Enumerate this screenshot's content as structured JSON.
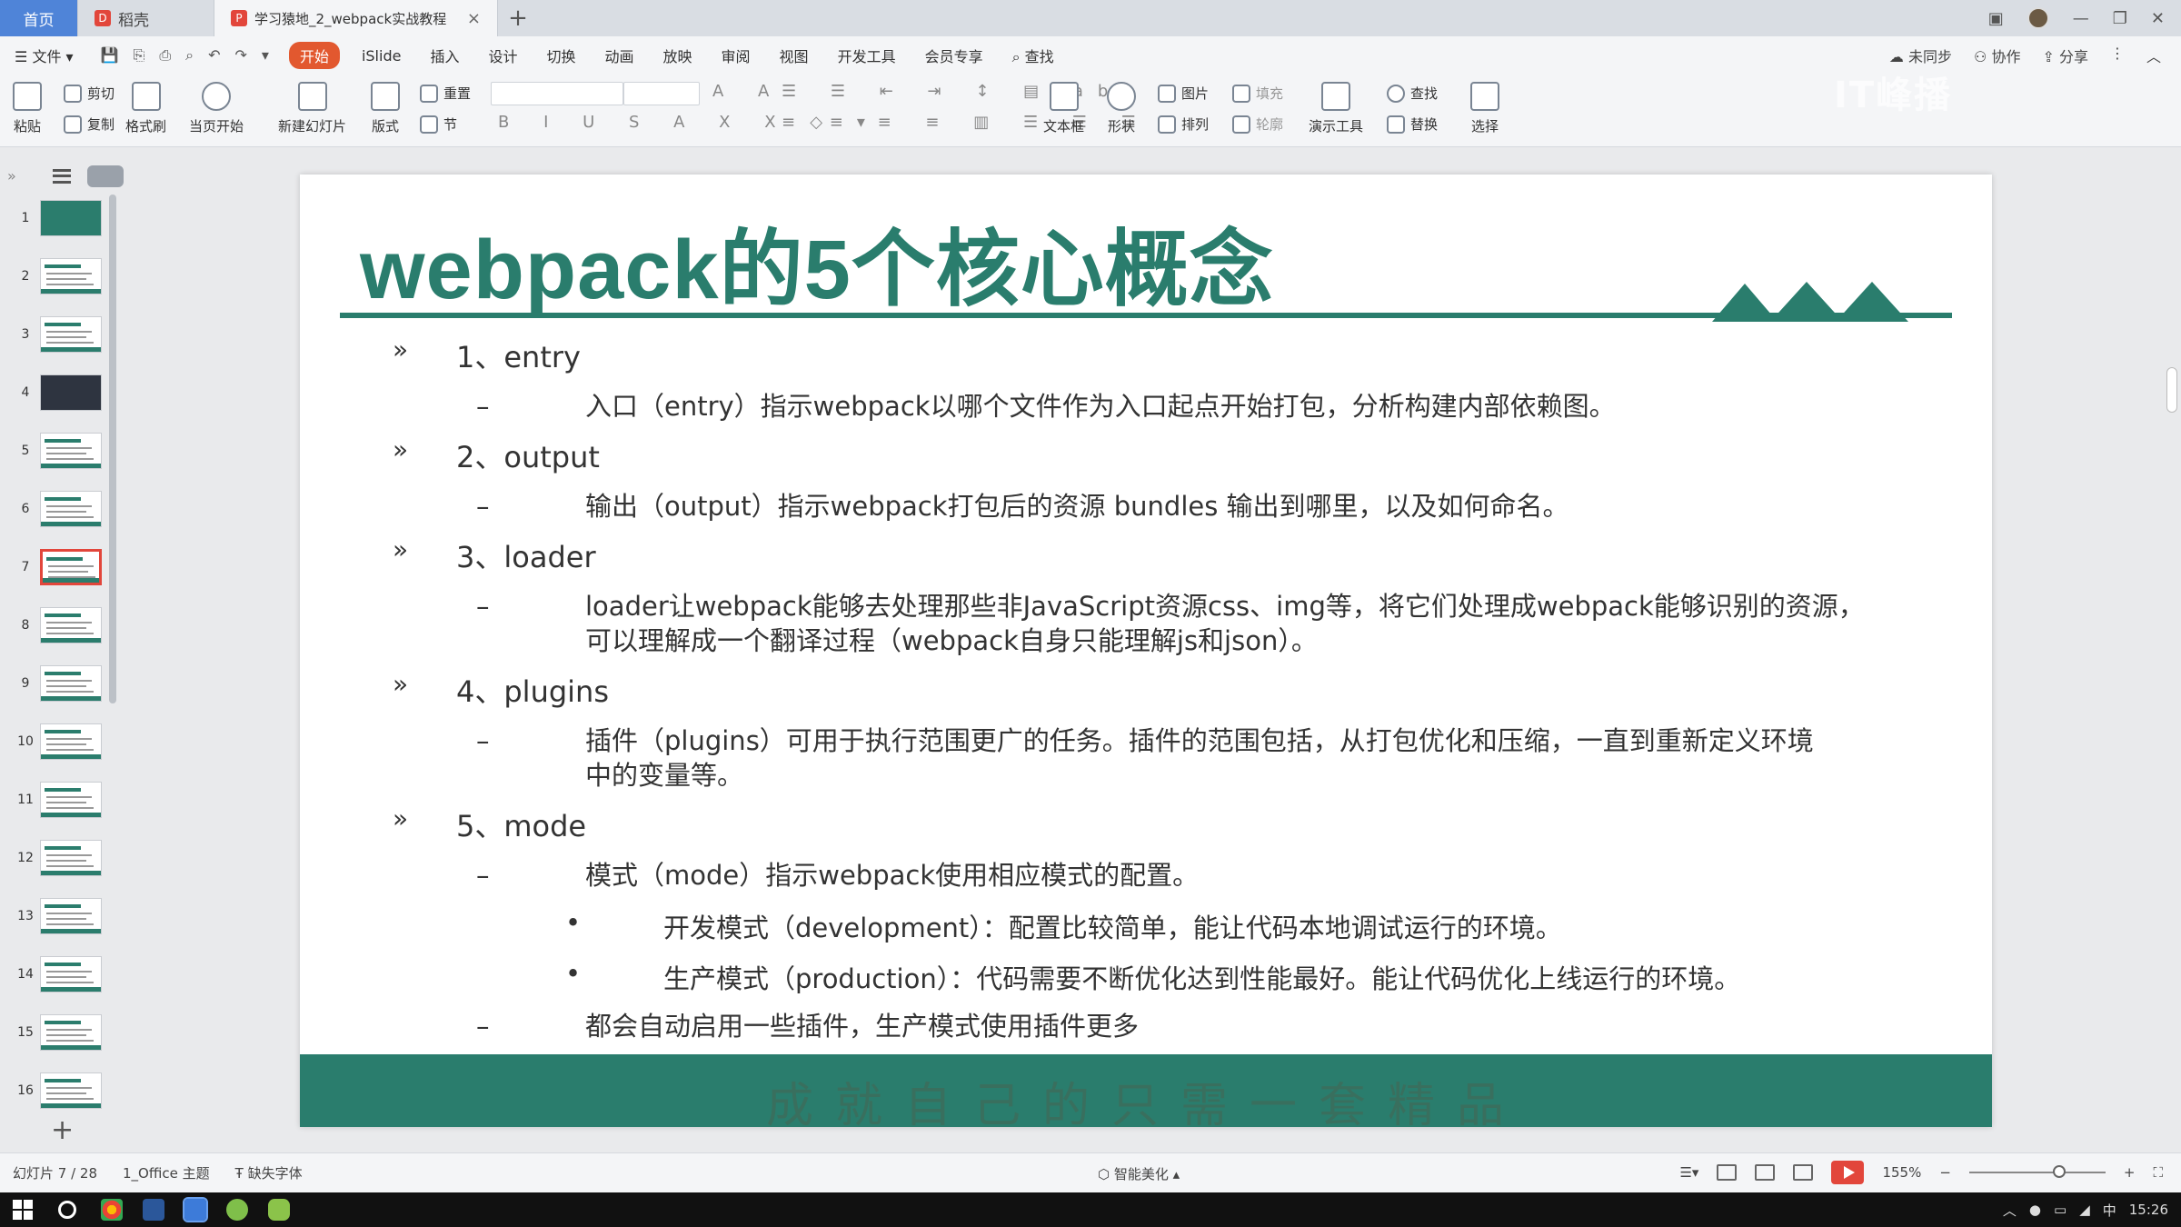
{
  "tabs": {
    "home": "首页",
    "daoke": "稻壳",
    "document": "学习猿地_2_webpack实战教程"
  },
  "menu": {
    "file": "文件",
    "items": [
      "开始",
      "iSlide",
      "插入",
      "设计",
      "切换",
      "动画",
      "放映",
      "审阅",
      "视图",
      "开发工具",
      "会员专享"
    ],
    "search": "查找",
    "right": [
      "未同步",
      "协作",
      "分享"
    ]
  },
  "ribbon": {
    "paste": "粘贴",
    "cut": "剪切",
    "copy": "复制",
    "format_painter": "格式刷",
    "from_current": "当页开始",
    "new_slide": "新建幻灯片",
    "layout": "版式",
    "reset": "重置",
    "section": "节",
    "textbox": "文本框",
    "shape": "形状",
    "arrange": "排列",
    "picture": "图片",
    "fill": "填充",
    "outline": "轮廓",
    "present_tools": "演示工具",
    "find": "查找",
    "replace": "替换",
    "select": "选择",
    "watermark": "IT峰播"
  },
  "slides_panel": {
    "numbers": [
      "1",
      "2",
      "3",
      "4",
      "5",
      "6",
      "7",
      "8",
      "9",
      "10",
      "11",
      "12",
      "13",
      "14",
      "15",
      "16"
    ],
    "selected": 7
  },
  "slide": {
    "title": "webpack的5个核心概念",
    "footer_text": "成就自己的只需一套精品",
    "bullets": {
      "b1": {
        "marker": "»",
        "text": "1、entry"
      },
      "b1_1": {
        "marker": "–",
        "text": "入口（entry）指示webpack以哪个文件作为入口起点开始打包，分析构建内部依赖图。"
      },
      "b2": {
        "marker": "»",
        "text": "2、output"
      },
      "b2_1": {
        "marker": "–",
        "text": "输出（output）指示webpack打包后的资源 bundles 输出到哪里，以及如何命名。"
      },
      "b3": {
        "marker": "»",
        "text": "3、loader"
      },
      "b3_1a": {
        "marker": "–",
        "text": "loader让webpack能够去处理那些非JavaScript资源css、img等，将它们处理成webpack能够识别的资源，"
      },
      "b3_1b": {
        "text": "可以理解成一个翻译过程（webpack自身只能理解js和json）。"
      },
      "b4": {
        "marker": "»",
        "text": "4、plugins"
      },
      "b4_1a": {
        "marker": "–",
        "text": "插件（plugins）可用于执行范围更广的任务。插件的范围包括，从打包优化和压缩，一直到重新定义环境"
      },
      "b4_1b": {
        "text": "中的变量等。"
      },
      "b5": {
        "marker": "»",
        "text": "5、mode"
      },
      "b5_1": {
        "marker": "–",
        "text": "模式（mode）指示webpack使用相应模式的配置。"
      },
      "b5_1_1": {
        "marker": "•",
        "text": "开发模式（development）：配置比较简单，能让代码本地调试运行的环境。"
      },
      "b5_1_2": {
        "marker": "•",
        "text": "生产模式（production）：代码需要不断优化达到性能最好。能让代码优化上线运行的环境。"
      },
      "b5_2": {
        "marker": "–",
        "text": "都会自动启用一些插件，生产模式使用插件更多"
      }
    },
    "theme_color": "#2a7d6d"
  },
  "statusbar": {
    "slide_info": "幻灯片 7 / 28",
    "theme": "1_Office 主题",
    "missing_font": "缺失字体",
    "beautify": "智能美化",
    "zoom": "155%"
  },
  "taskbar": {
    "clock": "15:26"
  }
}
